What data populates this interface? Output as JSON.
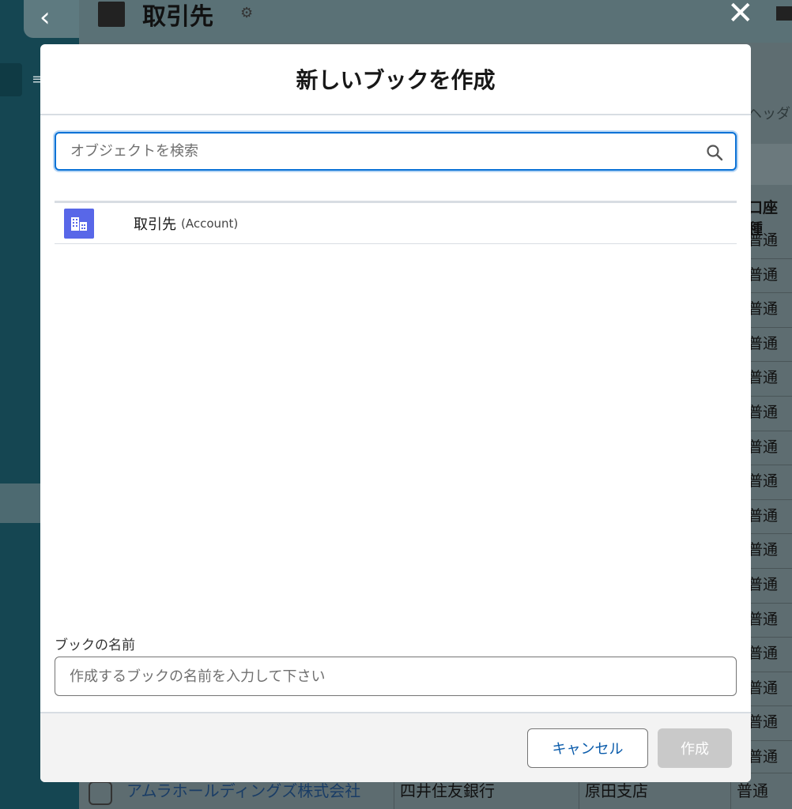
{
  "background": {
    "header": {
      "title": "取引先",
      "gear_icon": "gear-icon",
      "close_icon": "close-icon"
    },
    "sidebar": {
      "back_icon": "chevron-left-icon",
      "menu_icon": "menu-icon"
    },
    "partial_column_header": "ヘッダ",
    "partial_column_title": "口座種",
    "column_cells": [
      "普通",
      "普通",
      "普通",
      "普通",
      "普通",
      "普通",
      "普通",
      "普通",
      "普通",
      "普通",
      "普通",
      "普通",
      "普通",
      "普通",
      "普通",
      "普通"
    ],
    "bottom_row": {
      "account": "アムラホールディングズ株式会社",
      "bank": "四井住友銀行",
      "branch": "原田支店",
      "type": "普通"
    }
  },
  "modal": {
    "title": "新しいブックを作成",
    "search": {
      "placeholder": "オブジェクトを検索",
      "value": "",
      "icon": "search-icon"
    },
    "objects": [
      {
        "label": "取引先",
        "api_name": "(Account)",
        "icon": "building-icon",
        "icon_color": "#5867e8"
      }
    ],
    "book_name": {
      "label": "ブックの名前",
      "placeholder": "作成するブックの名前を入力して下さい",
      "value": ""
    },
    "footer": {
      "cancel_label": "キャンセル",
      "create_label": "作成"
    }
  },
  "colors": {
    "accent": "#0b72d6",
    "cancel_text": "#0b5cab",
    "disabled_button": "#c9c9c9"
  }
}
